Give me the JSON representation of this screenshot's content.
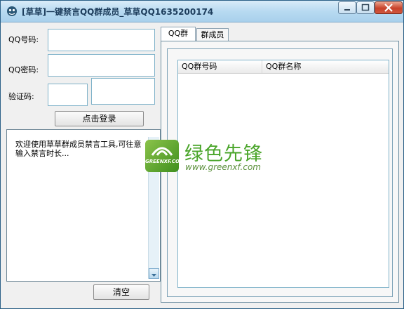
{
  "window": {
    "title": "[草草]一键禁言QQ群成员_草草QQ1635200174",
    "controls": {
      "minimize_icon": "minimize-icon",
      "maximize_icon": "maximize-icon",
      "close_icon": "close-icon"
    }
  },
  "login": {
    "qq_number_label": "QQ号码:",
    "qq_number_value": "",
    "qq_password_label": "QQ密码:",
    "qq_password_value": "",
    "captcha_label": "验证码:",
    "captcha_value": "",
    "login_button": "点击登录"
  },
  "log": {
    "text": "欢迎使用草草群成员禁言工具,可往意输入禁言时长...",
    "clear_button": "清空"
  },
  "tabs": [
    {
      "label": "QQ群",
      "active": true
    },
    {
      "label": "群成员",
      "active": false
    }
  ],
  "group_list": {
    "columns": [
      "QQ群号码",
      "QQ群名称"
    ],
    "rows": []
  },
  "watermark": {
    "logo_text": "GREENXF.COM",
    "name": "绿色先锋",
    "url": "www.greenxf.com"
  },
  "colors": {
    "title_gradient": "#b8daf1",
    "field_border": "#7fb2c9",
    "watermark_green": "#4aa52a"
  }
}
